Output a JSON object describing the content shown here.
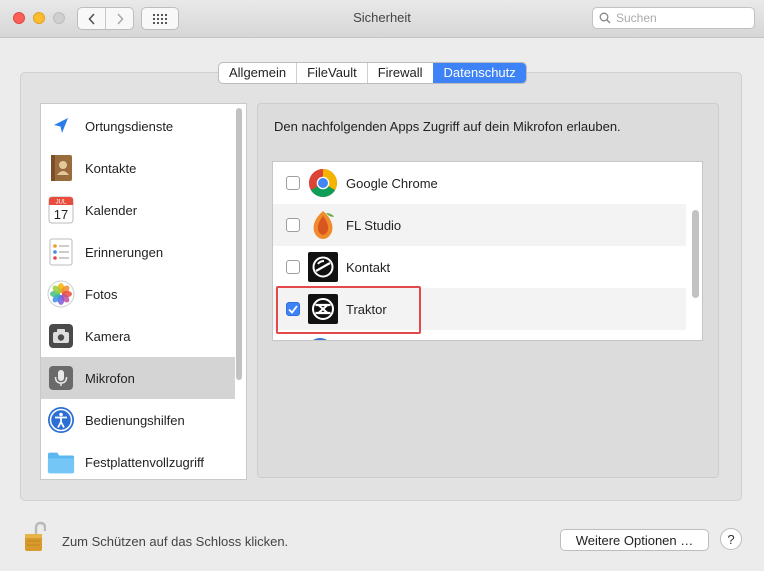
{
  "window": {
    "title": "Sicherheit",
    "nav_back": "‹",
    "nav_forward": "›",
    "search_placeholder": "Suchen"
  },
  "tabs": [
    {
      "label": "Allgemein",
      "active": false
    },
    {
      "label": "FileVault",
      "active": false
    },
    {
      "label": "Firewall",
      "active": false
    },
    {
      "label": "Datenschutz",
      "active": true
    }
  ],
  "sidebar": {
    "items": [
      {
        "label": "Ortungsdienste",
        "icon": "location-icon",
        "selected": false
      },
      {
        "label": "Kontakte",
        "icon": "contacts-icon",
        "selected": false
      },
      {
        "label": "Kalender",
        "icon": "calendar-icon",
        "selected": false,
        "icon_month": "JUL",
        "icon_day": "17"
      },
      {
        "label": "Erinnerungen",
        "icon": "reminders-icon",
        "selected": false
      },
      {
        "label": "Fotos",
        "icon": "photos-icon",
        "selected": false
      },
      {
        "label": "Kamera",
        "icon": "camera-icon",
        "selected": false
      },
      {
        "label": "Mikrofon",
        "icon": "microphone-icon",
        "selected": true
      },
      {
        "label": "Bedienungshilfen",
        "icon": "accessibility-icon",
        "selected": false
      },
      {
        "label": "Festplattenvollzugriff",
        "icon": "folder-icon",
        "selected": false
      }
    ]
  },
  "main": {
    "description": "Den nachfolgenden Apps Zugriff auf dein Mikrofon erlauben.",
    "apps": [
      {
        "label": "Google Chrome",
        "icon": "chrome-icon",
        "checked": false
      },
      {
        "label": "FL Studio",
        "icon": "fl-studio-icon",
        "checked": false
      },
      {
        "label": "Kontakt",
        "icon": "kontakt-icon",
        "checked": false
      },
      {
        "label": "Traktor",
        "icon": "traktor-icon",
        "checked": true
      }
    ]
  },
  "footer": {
    "lock_text": "Zum Schützen auf das Schloss klicken.",
    "options_button": "Weitere Optionen …",
    "help_button": "?"
  },
  "colors": {
    "accent": "#3d82f6",
    "highlight": "#e24a4a"
  }
}
